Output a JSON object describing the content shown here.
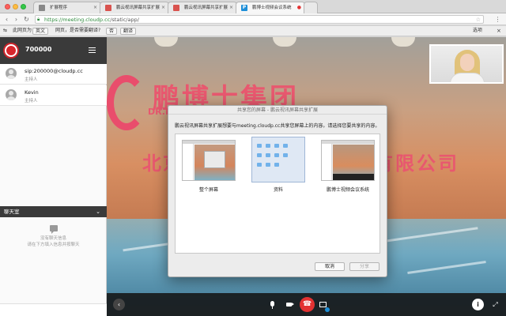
{
  "browser": {
    "tabs": [
      {
        "label": "扩展程序",
        "active": false
      },
      {
        "label": "鹏云视讯屏幕共享扩展 - Chr",
        "active": false
      },
      {
        "label": "鹏云视讯屏幕共享扩展 - 修改",
        "active": false
      },
      {
        "label": "鹏博士视频会议系统",
        "active": true
      }
    ],
    "url_host": "https://meeting.cloudp.cc",
    "url_path": "/static/app/",
    "translate": {
      "prefix": "此网页为",
      "language": "英文",
      "question": "网页，是否需要翻译?",
      "never_btn": "否",
      "translate_btn": "翻译",
      "options": "选项",
      "close": "×"
    }
  },
  "sidebar": {
    "room_id": "700000",
    "participants": [
      {
        "name": "sip:200000@cloudp.cc",
        "role": "主持人"
      },
      {
        "name": "Kevin",
        "role": "主持人"
      }
    ],
    "chat": {
      "title": "聊天室",
      "empty_line1": "没有聊天信息",
      "empty_line2": "请在下方填入信息并按聊天",
      "input_placeholder": ""
    }
  },
  "stage": {
    "wall_text_main": "鹏博士集团",
    "wall_text_sub": "DR.PENG",
    "wall_text_left": "北京",
    "wall_text_right": "有限公司"
  },
  "dialog": {
    "title": "共享您的屏幕 - 鹏云视讯屏幕共享扩展",
    "prompt": "鹏云视讯屏幕共享扩展想要与meeting.cloudp.cc共享您屏幕上的内容。请选择您要共享的内容。",
    "options": [
      {
        "label": "整个屏幕",
        "selected": false
      },
      {
        "label": "资料",
        "selected": true
      },
      {
        "label": "鹏博士视频会议系统",
        "selected": false
      }
    ],
    "cancel": "取消",
    "share": "分享"
  },
  "colors": {
    "header_dark": "#3a3a3a",
    "hangup_red": "#e33232",
    "brand_blue": "#1e8fd8",
    "wall_brand": "#e8586f"
  }
}
